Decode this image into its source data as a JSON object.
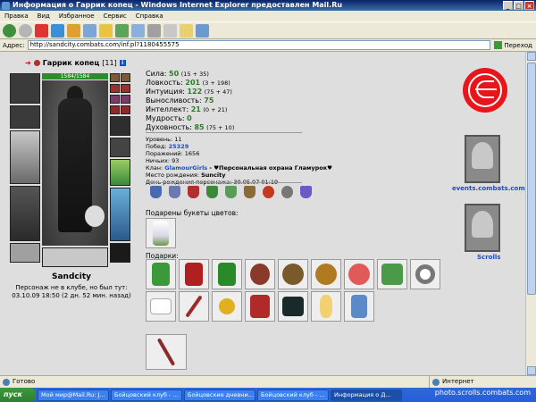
{
  "window": {
    "title": "Информация о Гаррик копец - Windows Internet Explorer предоставлен Mail.Ru"
  },
  "menu": [
    "Правка",
    "Вид",
    "Избранное",
    "Сервис",
    "Справка"
  ],
  "address": {
    "label": "Адрес:",
    "url": "http://sandcity.combats.com/inf.pl?1180455575",
    "go_label": "Переход"
  },
  "character": {
    "name": "Гаррик копец",
    "level": "[11]",
    "hp": "1584/1584",
    "city": "Sandcity",
    "club_note": "Персонаж не в клубе, но был тут:",
    "last_seen": "03.10.09 18:50 (2 дн. 52 мин. назад)"
  },
  "stats": [
    {
      "label": "Сила:",
      "value": "50",
      "mod": "(15 + 35)"
    },
    {
      "label": "Ловкость:",
      "value": "201",
      "mod": "(3 + 198)"
    },
    {
      "label": "Интуиция:",
      "value": "122",
      "mod": "(75 + 47)"
    },
    {
      "label": "Выносливость:",
      "value": "75",
      "mod": ""
    },
    {
      "label": "Интеллект:",
      "value": "21",
      "mod": "(0 + 21)"
    },
    {
      "label": "Мудрость:",
      "value": "0",
      "mod": ""
    },
    {
      "label": "Духовность:",
      "value": "85",
      "mod": "(75 + 10)"
    }
  ],
  "info": {
    "level": "Уровень: 11",
    "wins_label": "Побед:",
    "wins": "25329",
    "losses": "Поражений: 1656",
    "draws": "Ничьих: 93",
    "clan_label": "Клан:",
    "clan": "GlamourGirls",
    "clan_title": "- ♥Персональная охрана Гламурок♥",
    "birthplace_label": "Место рождения:",
    "birthplace": "Suncity",
    "birthday": "День рождения персонажа: 30.05.07 01:19"
  },
  "bouquets_label": "Подарены букеты цветов:",
  "gifts_label": "Подарки:",
  "emblems": {
    "events": "events.combats.com",
    "scrolls": "Scrolls"
  },
  "status": {
    "left": "Готово",
    "right": "Интернет"
  },
  "taskbar": {
    "start": "пуск",
    "tasks": [
      "Мой мир@Mail.Ru: J...",
      "Бойцовский клуб - ...",
      "Бойцовские дневни...",
      "Бойцовский клуб - ...",
      "Информация о Д..."
    ]
  },
  "watermark": "photo.scrolls.combats.com"
}
